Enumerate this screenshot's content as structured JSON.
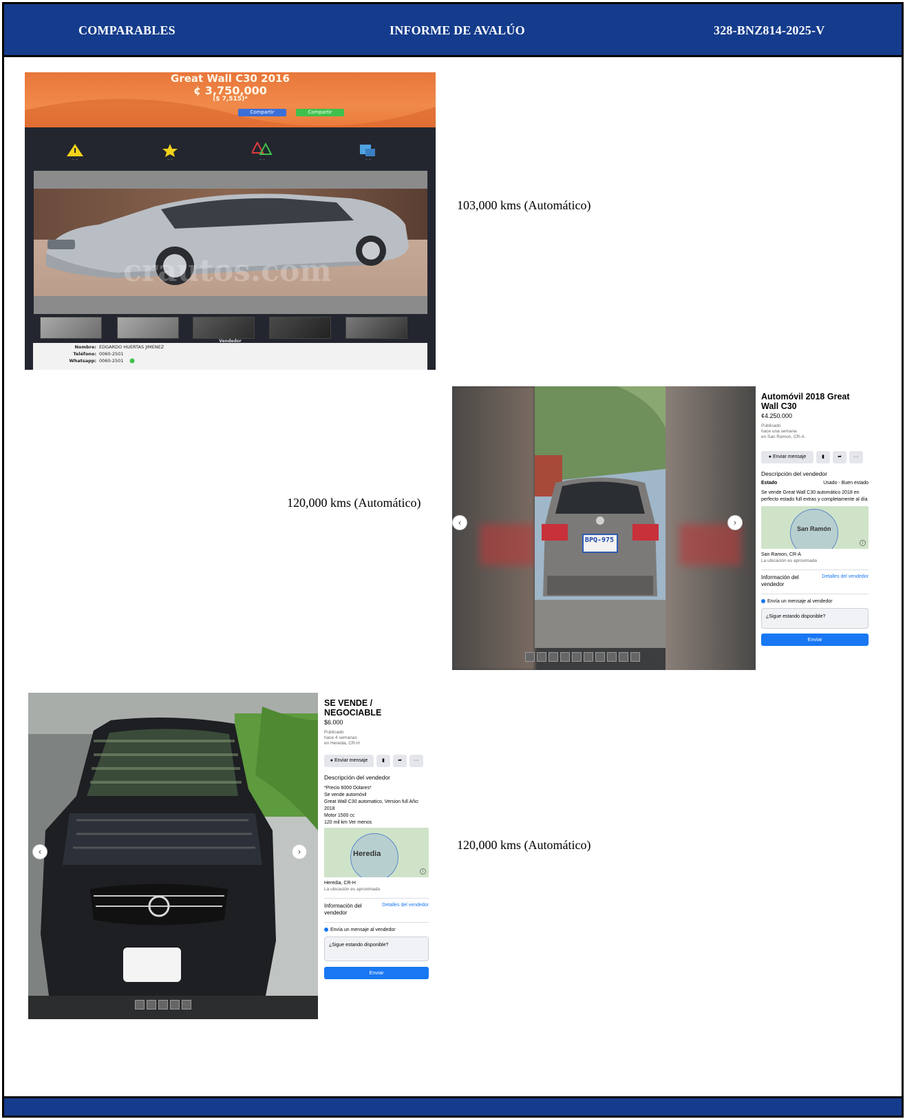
{
  "header": {
    "left": "COMPARABLES",
    "center": "INFORME DE AVALÚO",
    "right": "328-BNZ814-2025-V"
  },
  "comparables": [
    {
      "caption": "103,000 kms (Automático)",
      "listing": {
        "title": "Great Wall C30 2016",
        "price_crc": "¢ 3,750,000",
        "price_usd": "($ 7,515)*",
        "share_fb": "Compartir",
        "share_wa": "Compartir",
        "watermark": "crautos.com",
        "vendor_heading": "Vendedor",
        "vendor_name_label": "Nombre:",
        "vendor_name": "EDGARDO HUERTAS JIMENEZ",
        "vendor_phone_label": "Teléfono:",
        "vendor_phone": "0060-2501",
        "vendor_whatsapp_label": "Whatsapp:",
        "vendor_whatsapp": "0060-2501"
      }
    },
    {
      "caption": "120,000 kms (Automático)",
      "listing": {
        "title": "Automóvil 2018 Great Wall C30",
        "price": "¢4.250.000",
        "published_1": "Publicado",
        "published_2": "hace una semana",
        "published_3": "en San Ramon, CR-A",
        "message_btn": "Enviar mensaje",
        "desc_heading": "Descripción del vendedor",
        "state_label": "Estado",
        "state_value": "Usado - Buen estado",
        "description": "Se vende Great Wall C30 automático 2018 en perfecto estado full extras y completamente al día",
        "map_label": "San Ramón",
        "location": "San Ramon, CR-A",
        "location_note": "La ubicación es aproximada",
        "seller_info": "Información del vendedor",
        "seller_details": "Detalles del vendedor",
        "send_msg_label": "Envía un mensaje al vendedor",
        "input_value": "¿Sigue estando disponible?",
        "send_btn": "Enviar",
        "plate": "BPQ-975"
      }
    },
    {
      "caption": "120,000 kms (Automático)",
      "listing": {
        "title": "SE VENDE / NEGOCIABLE",
        "price": "$6.000",
        "published_1": "Publicado",
        "published_2": "hace 4 semanas",
        "published_3": "en Heredia, CR-H",
        "message_btn": "Enviar mensaje",
        "desc_heading": "Descripción del vendedor",
        "desc_lines": [
          "*Precio 6000 Dolares*",
          "Se vende automóvil",
          "Great Wall C30  automatico, Version full Año:",
          "2018",
          "Motor 1500 cc",
          "120 mil km Ver menos"
        ],
        "map_label": "Heredia",
        "location": "Heredia, CR-H",
        "location_note": "La ubicación es aproximada",
        "seller_info": "Información del vendedor",
        "seller_details": "Detalles del vendedor",
        "send_msg_label": "Envía un mensaje al vendedor",
        "input_value": "¿Sigue estando disponible?",
        "send_btn": "Enviar"
      }
    }
  ],
  "colors": {
    "band": "#153c8c",
    "fb_blue": "#1877f2",
    "banner_orange": "#ee8446"
  }
}
